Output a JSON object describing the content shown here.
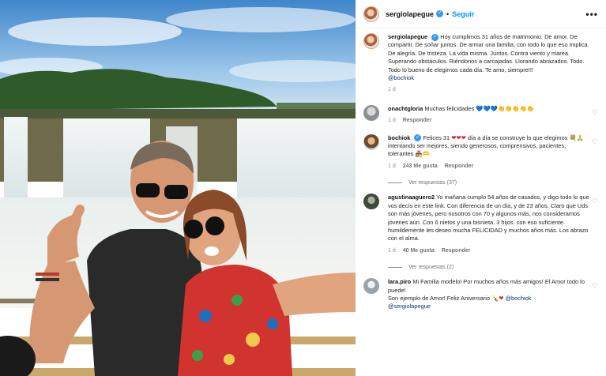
{
  "post": {
    "username": "sergiolapegue",
    "follow_label": "Seguir",
    "separator": "•",
    "more_label": "•••",
    "caption": "Hoy cumplimos 31 años de matrimonio. De amor. De compartir. De soñar juntos. De armar una familia, con todo lo que eso implica. De alegría. De tristeza. La vida misma. Juntos. Contra viento y marea. Superando obstáculos. Riéndonos a carcajadas. Llorando abrazados. Todo. Todo lo bueno de elegirnos cada día. Te amo, siempre!!!",
    "caption_mention": "@bochiok",
    "time": "1 d"
  },
  "comments": [
    {
      "username": "onachtgloria",
      "text": "Muchas felicidades",
      "emoji": "💙💙💙👏👏👏👏👏",
      "time": "1 d",
      "likes": "",
      "reply_label": "Responder"
    },
    {
      "username": "bochiok",
      "text_a": "Felices 31",
      "emoji_a": "❤❤❤",
      "text_b": "día a día se construye lo que elegimos",
      "emoji_b": "💐🙏",
      "text_c": "intentando ser mejores, siendo generosos, comprensivos, pacientes, tolerantes",
      "emoji_c": "👩‍❤️‍👨🫶",
      "time": "1 d",
      "likes": "243 Me gusta",
      "reply_label": "Responder",
      "view_replies": "Ver respuestas (37)"
    },
    {
      "username": "agustinaaguero2",
      "text": "Yo mañana cumplo 54 años de casados, y digo todo lo que vos decís en este link. Con diferencia de un día, y de 23 años. Claro que Uds son más jóvenes, pero nosotros con 70 y algunos más, nos consideramos jóvenes aún. Con 6 nietos y una bisnieta. 3 hijos. con eso suficiente. humildemente les deseo mucha FELICIDAD y muchos años más. Los abrazo con el alma.",
      "time": "1 d",
      "likes": "40 Me gusta",
      "reply_label": "Responder",
      "view_replies": "Ver respuestas (2)"
    },
    {
      "username": "lara.piro",
      "text": "Mi Familia modelo! Por muchos años más amigos! El Amor todo lo puede!",
      "text_b": "Son ejemplo de Amor! Feliz Aniversario",
      "emoji_b": "🍾❤",
      "mention": "@bochiok",
      "mention_b": "@sergiolapegue"
    }
  ],
  "icons": {
    "heart": "♡",
    "verified": "✓"
  },
  "colors": {
    "link": "#0095f6",
    "mention": "#00376b",
    "verified": "#3897f0",
    "muted": "#8e8e8e"
  }
}
